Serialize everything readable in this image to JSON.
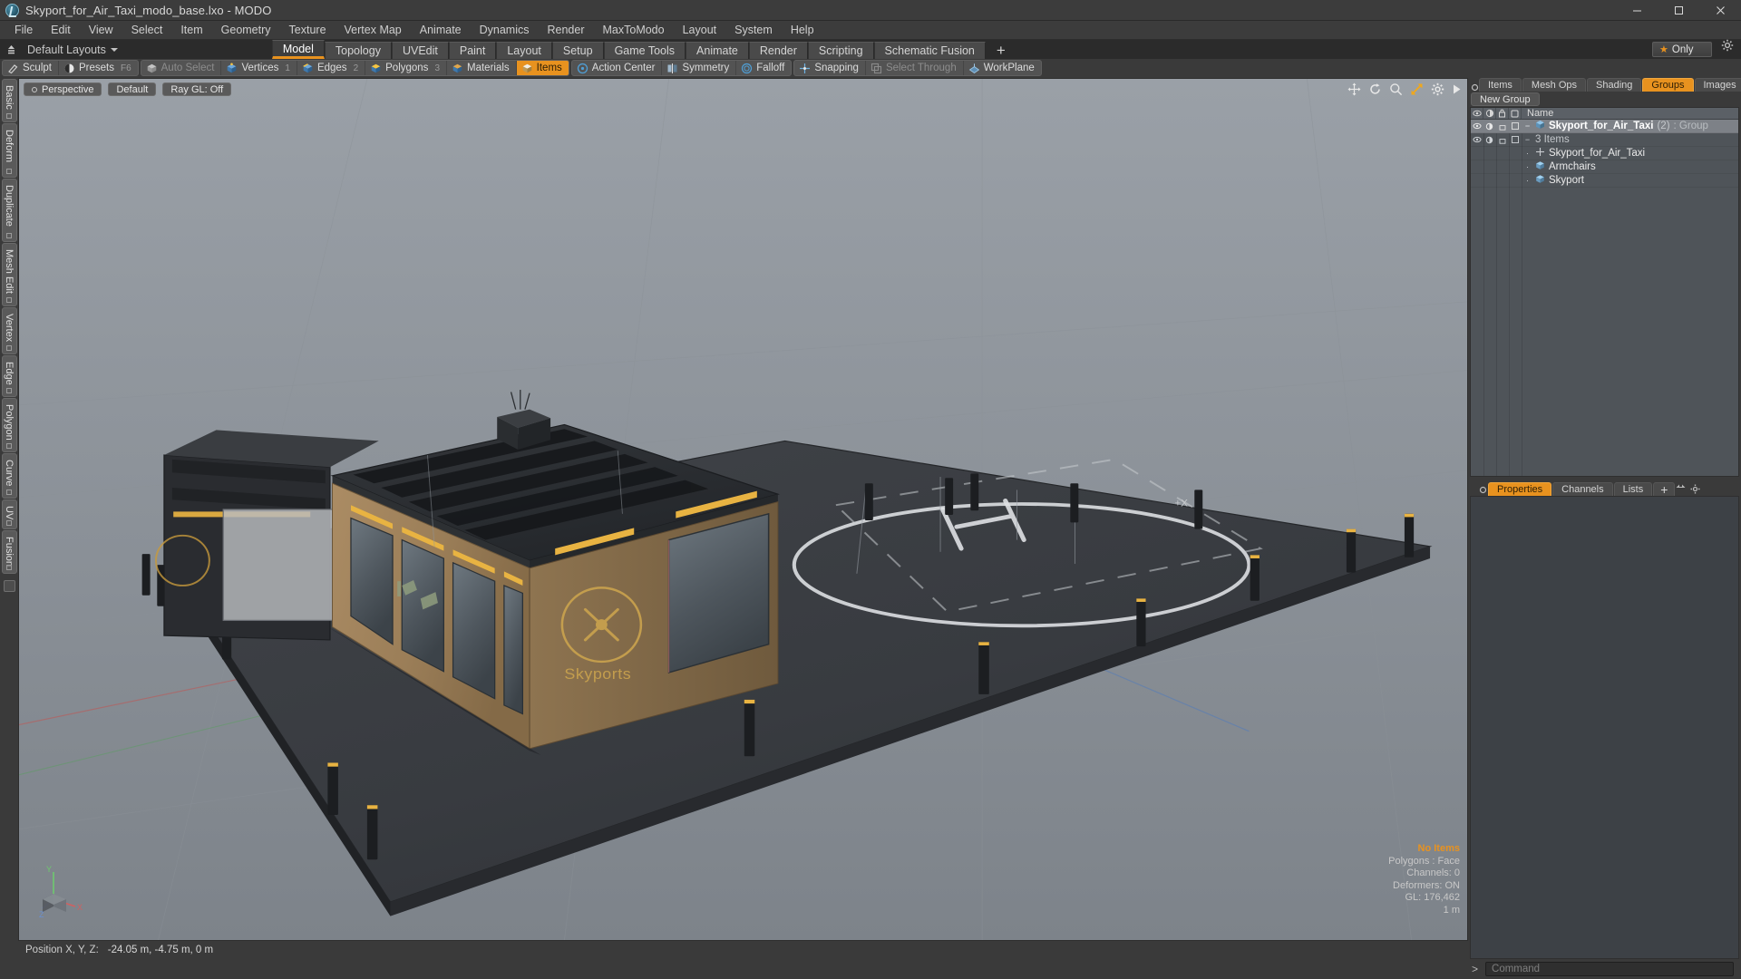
{
  "window": {
    "title": "Skyport_for_Air_Taxi_modo_base.lxo - MODO",
    "logo_icon": "modo-logo-icon",
    "minimize_icon": "minimize-icon",
    "maximize_icon": "maximize-icon",
    "close_icon": "close-icon"
  },
  "menubar": {
    "items": [
      {
        "label": "File"
      },
      {
        "label": "Edit"
      },
      {
        "label": "View"
      },
      {
        "label": "Select"
      },
      {
        "label": "Item"
      },
      {
        "label": "Geometry"
      },
      {
        "label": "Texture"
      },
      {
        "label": "Vertex Map"
      },
      {
        "label": "Animate"
      },
      {
        "label": "Dynamics"
      },
      {
        "label": "Render"
      },
      {
        "label": "MaxToModo"
      },
      {
        "label": "Layout"
      },
      {
        "label": "System"
      },
      {
        "label": "Help"
      }
    ]
  },
  "layoutbar": {
    "home_icon": "home-layout-icon",
    "layouts_label": "Default Layouts",
    "dropdown_icon": "chevron-down-icon",
    "tabs": [
      {
        "label": "Model",
        "active": true
      },
      {
        "label": "Topology",
        "active": false
      },
      {
        "label": "UVEdit",
        "active": false
      },
      {
        "label": "Paint",
        "active": false
      },
      {
        "label": "Layout",
        "active": false
      },
      {
        "label": "Setup",
        "active": false
      },
      {
        "label": "Game Tools",
        "active": false
      },
      {
        "label": "Animate",
        "active": false
      },
      {
        "label": "Render",
        "active": false
      },
      {
        "label": "Scripting",
        "active": false
      },
      {
        "label": "Schematic Fusion",
        "active": false
      }
    ],
    "add_tab_label": "+",
    "only_button": {
      "label": "Only",
      "star_icon": "star-icon"
    },
    "settings_icon": "gear-icon",
    "accent_color": "#e8921f"
  },
  "toolbar": {
    "groups": [
      {
        "buttons": [
          {
            "label": "Sculpt",
            "icon": "sculpt-brush-icon",
            "state": "normal",
            "key": ""
          },
          {
            "label": "Presets",
            "icon": "presets-sphere-icon",
            "state": "normal",
            "key": "F6"
          }
        ]
      },
      {
        "buttons": [
          {
            "label": "Auto Select",
            "icon": "cube-grey-icon",
            "state": "dim",
            "key": ""
          },
          {
            "label": "Vertices",
            "icon": "cube-vertices-icon",
            "state": "normal",
            "key": "1"
          },
          {
            "label": "Edges",
            "icon": "cube-edges-icon",
            "state": "normal",
            "key": "2"
          },
          {
            "label": "Polygons",
            "icon": "cube-polygons-icon",
            "state": "normal",
            "key": "3"
          },
          {
            "label": "Materials",
            "icon": "cube-materials-icon",
            "state": "normal",
            "key": ""
          },
          {
            "label": "Items",
            "icon": "cube-items-icon",
            "state": "on",
            "key": ""
          }
        ]
      },
      {
        "buttons": [
          {
            "label": "Action Center",
            "icon": "action-center-icon",
            "state": "normal",
            "key": ""
          },
          {
            "label": "Symmetry",
            "icon": "symmetry-icon",
            "state": "normal",
            "key": ""
          },
          {
            "label": "Falloff",
            "icon": "falloff-icon",
            "state": "normal",
            "key": ""
          }
        ]
      },
      {
        "buttons": [
          {
            "label": "Snapping",
            "icon": "snapping-icon",
            "state": "normal",
            "key": ""
          },
          {
            "label": "Select Through",
            "icon": "select-through-icon",
            "state": "dim",
            "key": ""
          },
          {
            "label": "WorkPlane",
            "icon": "workplane-icon",
            "state": "normal",
            "key": ""
          }
        ]
      }
    ]
  },
  "left_tabs": [
    {
      "label": "Basic"
    },
    {
      "label": "Deform"
    },
    {
      "label": "Duplicate"
    },
    {
      "label": "Mesh Edit"
    },
    {
      "label": "Vertex"
    },
    {
      "label": "Edge"
    },
    {
      "label": "Polygon"
    },
    {
      "label": "Curve"
    },
    {
      "label": "UV"
    },
    {
      "label": "Fusion"
    }
  ],
  "viewport": {
    "pills": [
      {
        "label": "Perspective",
        "icon": "viewport-mode-icon"
      },
      {
        "label": "Default",
        "icon": ""
      },
      {
        "label": "Ray GL: Off",
        "icon": ""
      }
    ],
    "tools": [
      {
        "icon": "move-icon"
      },
      {
        "icon": "rotate-icon"
      },
      {
        "icon": "zoom-icon"
      },
      {
        "icon": "fit-icon"
      },
      {
        "icon": "gear-icon"
      },
      {
        "icon": "play-arrow-icon"
      }
    ],
    "stats": {
      "selection": "No Items",
      "polygons": "Polygons : Face",
      "channels": "Channels: 0",
      "deformers": "Deformers: ON",
      "gl": "GL: 176,462",
      "scale": "1 m"
    },
    "axis": {
      "x": "X",
      "y": "Y",
      "z": "Z"
    },
    "gizmo_label": "+X"
  },
  "position_bar": {
    "label": "Position X, Y, Z:",
    "values": "-24.05 m, -4.75 m, 0 m"
  },
  "right_panel": {
    "tabs": [
      {
        "label": "Items",
        "active": false
      },
      {
        "label": "Mesh Ops",
        "active": false
      },
      {
        "label": "Shading",
        "active": false
      },
      {
        "label": "Groups",
        "active": true
      },
      {
        "label": "Images",
        "active": false
      },
      {
        "label": "+",
        "active": false
      }
    ],
    "new_group_label": "New Group",
    "column_header": "Name",
    "header_icons": [
      "eye-icon",
      "render-icon",
      "lock-icon",
      "select-icon"
    ],
    "items": [
      {
        "label": "Skyport_for_Air_Taxi",
        "count": "(2)",
        "meta": ": Group",
        "indent": 0,
        "selected": true,
        "expander": "minus",
        "icon": "group-icon"
      },
      {
        "label": "3 Items",
        "count": "",
        "meta": "",
        "indent": 1,
        "selected": false,
        "expander": "minus",
        "icon": ""
      },
      {
        "label": "Skyport_for_Air_Taxi",
        "count": "",
        "meta": "",
        "indent": 2,
        "selected": false,
        "expander": "dot",
        "icon": "locator-icon"
      },
      {
        "label": "Armchairs",
        "count": "",
        "meta": "",
        "indent": 2,
        "selected": false,
        "expander": "dot",
        "icon": "mesh-icon"
      },
      {
        "label": "Skyport",
        "count": "",
        "meta": "",
        "indent": 2,
        "selected": false,
        "expander": "dot",
        "icon": "mesh-icon"
      }
    ],
    "bottom_tabs": [
      {
        "label": "Properties",
        "active": true
      },
      {
        "label": "Channels",
        "active": false
      },
      {
        "label": "Lists",
        "active": false
      },
      {
        "label": "+",
        "active": false
      }
    ]
  },
  "command_bar": {
    "prompt": ">",
    "placeholder": "Command",
    "value": ""
  }
}
